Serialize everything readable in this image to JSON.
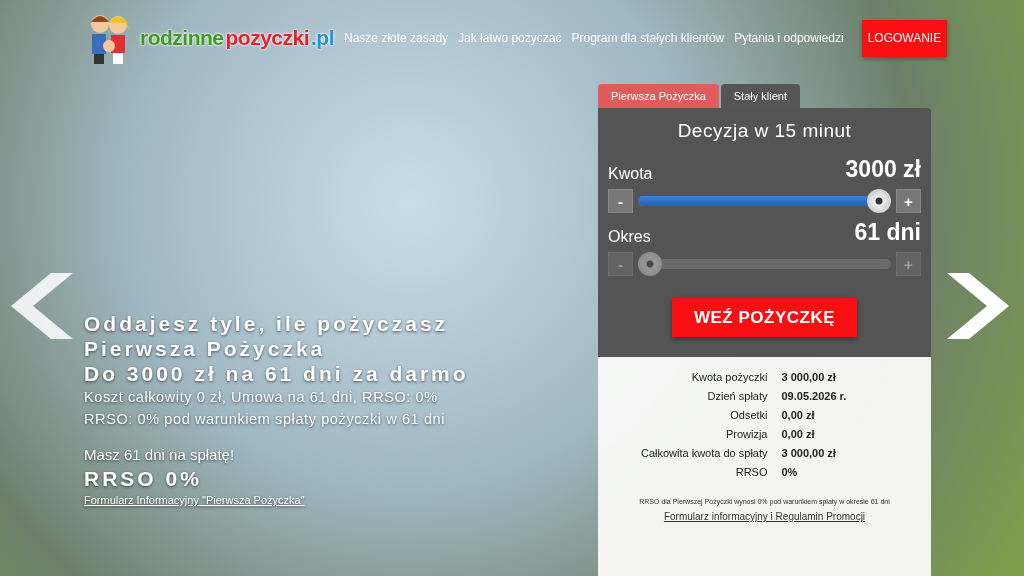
{
  "header": {
    "logo": [
      {
        "text": "rodzinne",
        "color": "#3f9a1c"
      },
      {
        "text": "pozyczki",
        "color": "#e8202a"
      },
      {
        "text": ".pl",
        "color": "#2a8fd0"
      }
    ],
    "nav": [
      "Nasze złote zasady",
      "Jak łatwo pożyczać",
      "Program dla stałych klientów",
      "Pytania i odpowiedzi"
    ],
    "login_button": "LOGOWANIE"
  },
  "hero": {
    "headline": "Oddajesz tyle, ile pożyczasz",
    "subtitle": "Pierwsza Pożyczka",
    "offer": "Do 3000 zł na 61 dni za darmo",
    "details": [
      "Koszt całkowity 0 zł, Umowa na 61 dni, RRSO: 0%",
      "RRSO: 0% pod warunkiem spłaty pożyczki w 61 dni"
    ],
    "note": "Masz 61 dni na spłatę!",
    "rrso": "RRSO 0%",
    "link": "Formularz Informacyjny \"Pierwsza Pożyczka\""
  },
  "calculator": {
    "tabs": [
      {
        "label": "Pierwsza Pożyczka",
        "selected": true
      },
      {
        "label": "Stały klient",
        "selected": false
      }
    ],
    "title": "Decyzja w 15 minut",
    "sliders": [
      {
        "label": "Kwota",
        "reading": "3000 zł",
        "level": 1,
        "disabled": false,
        "minus": "-",
        "plus": "+"
      },
      {
        "label": "Okres",
        "reading": "61 dni",
        "level": 0,
        "disabled": true,
        "minus": "-",
        "plus": "+"
      }
    ],
    "button": "WEŹ POŻYCZKĘ",
    "summary": [
      {
        "label": "Kwota pożyczki",
        "value": "3 000,00 zł"
      },
      {
        "label": "Dzień spłaty",
        "value": "09.05.2026 r."
      },
      {
        "label": "Odsetki",
        "value": "0,00 zł"
      },
      {
        "label": "Prowizja",
        "value": "0,00 zł"
      },
      {
        "label": "Całkowita kwota do spłaty",
        "value": "3 000,00 zł"
      },
      {
        "label": "RRSO",
        "value": "0%"
      }
    ],
    "footnote": "RRSO dla Pierwszej Pożyczki wynosi 0% pod warunkiem spłaty w okresie 61 dni",
    "link": "Formularz informacyjny i Regulamin Promocji"
  }
}
